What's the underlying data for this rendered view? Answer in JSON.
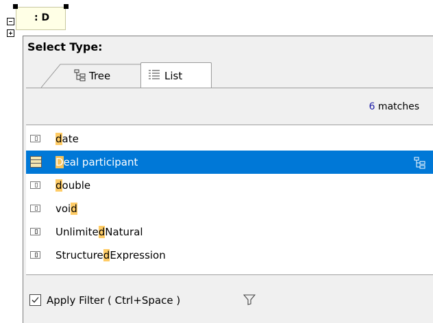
{
  "diagram": {
    "element_label": ": D"
  },
  "popup": {
    "title": "Select Type:",
    "tabs": [
      {
        "label": "Tree",
        "icon": "tree-icon",
        "active": false
      },
      {
        "label": "List",
        "icon": "list-icon",
        "active": true
      }
    ],
    "matches": {
      "count": "6",
      "suffix": " matches"
    },
    "items": [
      {
        "pre": "",
        "hl": "d",
        "post": "ate",
        "icon": "datatype-icon",
        "selected": false
      },
      {
        "pre": "",
        "hl": "D",
        "post": "eal participant",
        "icon": "class-icon",
        "selected": true
      },
      {
        "pre": "",
        "hl": "d",
        "post": "ouble",
        "icon": "datatype-icon",
        "selected": false
      },
      {
        "pre": "voi",
        "hl": "d",
        "post": "",
        "icon": "datatype-icon",
        "selected": false
      },
      {
        "pre": "Unlimite",
        "hl": "d",
        "post": "Natural",
        "icon": "primitive-type-icon",
        "selected": false
      },
      {
        "pre": "Structure",
        "hl": "d",
        "post": "Expression",
        "icon": "primitive-type-icon",
        "selected": false
      }
    ],
    "filter": {
      "label": "Apply Filter ( Ctrl+Space )",
      "checked": true,
      "icon": "filter-funnel-icon"
    },
    "accent": "#0078d7",
    "highlight": "#ffcc66"
  }
}
